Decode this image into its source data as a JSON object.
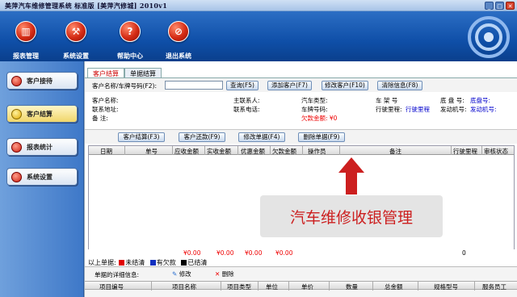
{
  "window": {
    "title": "美萍汽车维修管理系统 标准版 [美萍汽修城]   2010v1",
    "min": "_",
    "max": "□",
    "close": "✕"
  },
  "toolbar": {
    "items": [
      {
        "label": "报表管理",
        "icon": "chart-icon",
        "glyph": "▥"
      },
      {
        "label": "系统设置",
        "icon": "tools-icon",
        "glyph": "⚒"
      },
      {
        "label": "帮助中心",
        "icon": "help-icon",
        "glyph": "?"
      },
      {
        "label": "退出系统",
        "icon": "exit-icon",
        "glyph": "⊘"
      }
    ]
  },
  "sidebar": {
    "items": [
      {
        "label": "客户接待"
      },
      {
        "label": "客户结算"
      },
      {
        "label": "报表统计"
      },
      {
        "label": "系统设置"
      }
    ]
  },
  "tabs": [
    {
      "label": "客户结算"
    },
    {
      "label": "单据结算"
    }
  ],
  "search": {
    "label": "客户名称/车牌号码(F2):",
    "value": "",
    "query": "查询(F5)",
    "add": "添加客户(F7)",
    "edit": "修改客户(F10)",
    "clear": "清除信息(F8)"
  },
  "info": {
    "name": "客户名称:",
    "addr": "联系地址:",
    "note": "备    注:",
    "contact": "主联系人:",
    "phone": "联系电话:",
    "cartype": "汽车类型:",
    "plate": "车牌号码:",
    "owe": "欠款金额: ¥0",
    "frame": "车 架 号",
    "mileage": "行驶里程:",
    "mileage_v": "行驶里程",
    "chassis": "底 盘 号:",
    "chassis_v": "底盘号:",
    "engine": "发动机号:",
    "engine_v": "发动机号:"
  },
  "actions": {
    "settle": "客户结算(F3)",
    "repay": "客户还款(F9)",
    "edit": "修改单据(F4)",
    "del": "删除单据(F9)"
  },
  "grid": {
    "columns": [
      "日期",
      "单号",
      "应收金额",
      "实收金额",
      "优惠金额",
      "欠款金额",
      "操作员",
      "备注",
      "行驶里程",
      "审核状态"
    ],
    "totals": [
      "¥0.00",
      "¥0.00",
      "¥0.00",
      "¥0.00",
      "0"
    ]
  },
  "legend": {
    "prefix": "以上单据:",
    "unpaid": "未结清",
    "owing": "有欠款",
    "done": "已结清",
    "colors": {
      "unpaid": "#e00000",
      "owing": "#1030c0",
      "done": "#000000"
    }
  },
  "detail": {
    "label": "单据的详细信息:",
    "edit": "修改",
    "del": "删除",
    "columns": [
      "项目编号",
      "项目名称",
      "项目类型",
      "单位",
      "单价",
      "数量",
      "总金额",
      "规格型号",
      "服务员工"
    ]
  },
  "overlay": {
    "text": "汽车维修收银管理"
  }
}
